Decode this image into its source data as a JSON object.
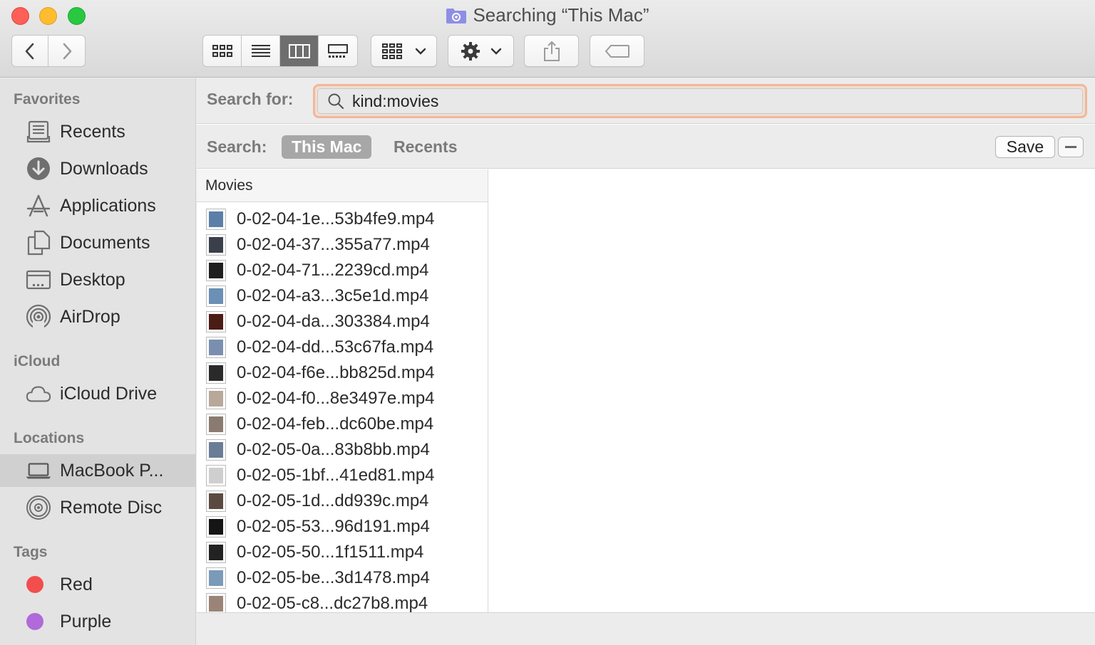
{
  "window": {
    "title": "Searching “This Mac”"
  },
  "toolbar": {
    "back_icon": "chevron-left-icon",
    "forward_icon": "chevron-right-icon",
    "view_modes": [
      "icon-view",
      "list-view",
      "column-view",
      "gallery-view"
    ],
    "active_view": "column-view",
    "group_icon": "group-by-icon",
    "action_icon": "gear-icon",
    "share_icon": "share-icon",
    "tag_icon": "tag-icon"
  },
  "sidebar": {
    "favorites_heading": "Favorites",
    "favorites": [
      {
        "label": "Recents",
        "icon": "recents-icon"
      },
      {
        "label": "Downloads",
        "icon": "downloads-icon"
      },
      {
        "label": "Applications",
        "icon": "applications-icon"
      },
      {
        "label": "Documents",
        "icon": "documents-icon"
      },
      {
        "label": "Desktop",
        "icon": "desktop-icon"
      },
      {
        "label": "AirDrop",
        "icon": "airdrop-icon"
      }
    ],
    "icloud_heading": "iCloud",
    "icloud": [
      {
        "label": "iCloud Drive",
        "icon": "cloud-icon"
      }
    ],
    "locations_heading": "Locations",
    "locations": [
      {
        "label": "MacBook P...",
        "icon": "laptop-icon",
        "selected": true
      },
      {
        "label": "Remote Disc",
        "icon": "disc-icon"
      }
    ],
    "tags_heading": "Tags",
    "tags": [
      {
        "label": "Red",
        "color": "#f24e4e"
      },
      {
        "label": "Purple",
        "color": "#b06ad9"
      }
    ]
  },
  "search": {
    "label": "Search for:",
    "query": "kind:movies",
    "scope_label": "Search:",
    "scope_this_mac": "This Mac",
    "scope_recents": "Recents",
    "save_label": "Save"
  },
  "results": {
    "column_header": "Movies",
    "files": [
      "0-02-04-1e...53b4fe9.mp4",
      "0-02-04-37...355a77.mp4",
      "0-02-04-71...2239cd.mp4",
      "0-02-04-a3...3c5e1d.mp4",
      "0-02-04-da...303384.mp4",
      "0-02-04-dd...53c67fa.mp4",
      "0-02-04-f6e...bb825d.mp4",
      "0-02-04-f0...8e3497e.mp4",
      "0-02-04-feb...dc60be.mp4",
      "0-02-05-0a...83b8bb.mp4",
      "0-02-05-1bf...41ed81.mp4",
      "0-02-05-1d...dd939c.mp4",
      "0-02-05-53...96d191.mp4",
      "0-02-05-50...1f1511.mp4",
      "0-02-05-be...3d1478.mp4",
      "0-02-05-c8...dc27b8.mp4"
    ],
    "thumb_colors": [
      "#5b7fa8",
      "#3a3f4a",
      "#1f1f1f",
      "#6b8fb5",
      "#4a1c14",
      "#7a8fb0",
      "#2a2a2a",
      "#b8a89a",
      "#8a7a70",
      "#6a7d96",
      "#cfcfcf",
      "#5a4a40",
      "#151515",
      "#222222",
      "#7a9ab8",
      "#9a8478"
    ]
  }
}
